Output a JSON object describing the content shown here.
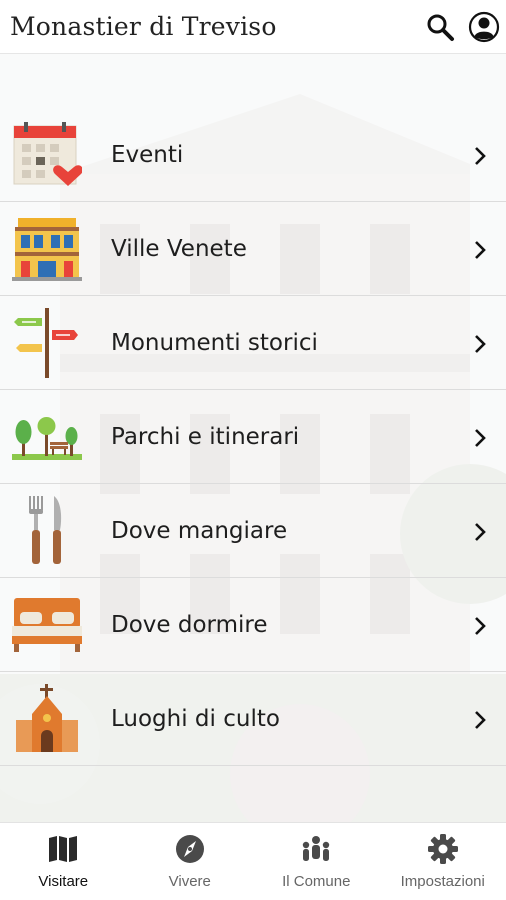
{
  "header": {
    "title": "Monastier di Treviso",
    "search_icon": "search-icon",
    "user_icon": "user-icon"
  },
  "menu": {
    "items": [
      {
        "label": "Eventi",
        "icon": "calendar-heart-icon"
      },
      {
        "label": "Ville Venete",
        "icon": "villa-building-icon"
      },
      {
        "label": "Monumenti storici",
        "icon": "signpost-icon"
      },
      {
        "label": "Parchi e itinerari",
        "icon": "park-trees-icon"
      },
      {
        "label": "Dove mangiare",
        "icon": "fork-knife-icon"
      },
      {
        "label": "Dove dormire",
        "icon": "bed-icon"
      },
      {
        "label": "Luoghi di culto",
        "icon": "church-icon"
      }
    ]
  },
  "bottom_nav": {
    "items": [
      {
        "label": "Visitare",
        "icon": "map-icon",
        "active": true
      },
      {
        "label": "Vivere",
        "icon": "compass-icon",
        "active": false
      },
      {
        "label": "Il Comune",
        "icon": "people-icon",
        "active": false
      },
      {
        "label": "Impostazioni",
        "icon": "gear-icon",
        "active": false
      }
    ]
  },
  "colors": {
    "accent_red": "#e8433a",
    "text": "#1e1e1e",
    "divider": "#dcdcdc"
  }
}
